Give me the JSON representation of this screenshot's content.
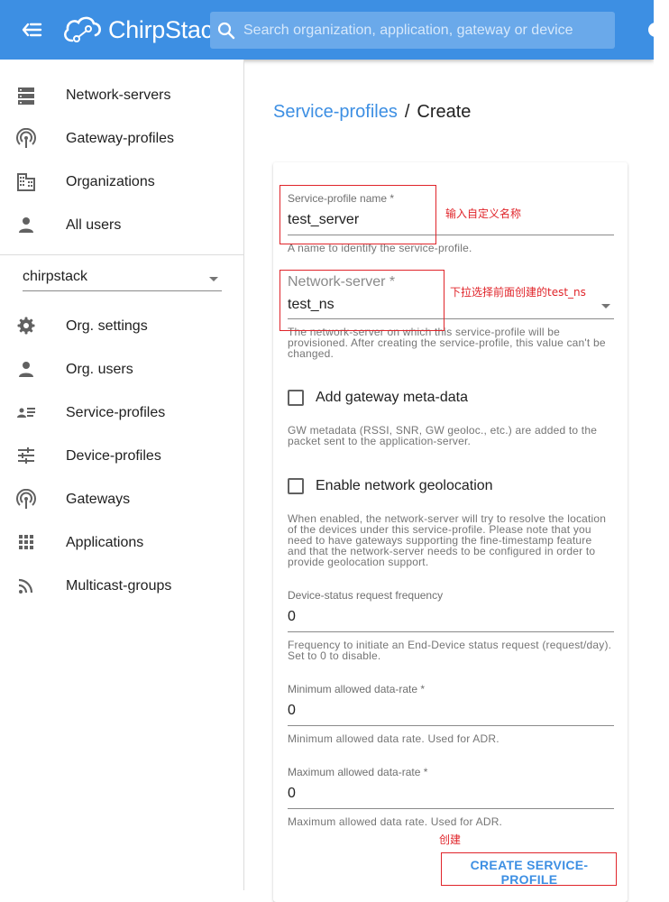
{
  "header": {
    "logo_text": "ChirpStack",
    "search_placeholder": "Search organization, application, gateway or device"
  },
  "sidebar": {
    "admin_items": [
      {
        "label": "Network-servers",
        "icon": "server-icon"
      },
      {
        "label": "Gateway-profiles",
        "icon": "radio-tower-icon"
      },
      {
        "label": "Organizations",
        "icon": "building-icon"
      },
      {
        "label": "All users",
        "icon": "person-icon"
      }
    ],
    "organization_select": "chirpstack",
    "org_items": [
      {
        "label": "Org. settings",
        "icon": "gear-icon"
      },
      {
        "label": "Org. users",
        "icon": "person-icon"
      },
      {
        "label": "Service-profiles",
        "icon": "account-list-icon"
      },
      {
        "label": "Device-profiles",
        "icon": "tune-icon"
      },
      {
        "label": "Gateways",
        "icon": "radio-tower-icon"
      },
      {
        "label": "Applications",
        "icon": "apps-grid-icon"
      },
      {
        "label": "Multicast-groups",
        "icon": "rss-feed-icon"
      }
    ]
  },
  "breadcrumb": {
    "parent": "Service-profiles",
    "separator": "/",
    "current": "Create"
  },
  "form": {
    "name": {
      "label": "Service-profile name *",
      "value": "test_server",
      "helper": "A name to identify the service-profile."
    },
    "network_server": {
      "label": "Network-server *",
      "value": "test_ns",
      "helper": "The network-server on which this service-profile will be provisioned. After creating the service-profile, this value can't be changed."
    },
    "add_gw_metadata": {
      "label": "Add gateway meta-data",
      "checked": false,
      "helper": "GW metadata (RSSI, SNR, GW geoloc., etc.) are added to the packet sent to the application-server."
    },
    "network_geolocation": {
      "label": "Enable network geolocation",
      "checked": false,
      "helper": "When enabled, the network-server will try to resolve the location of the devices under this service-profile. Please note that you need to have gateways supporting the fine-timestamp feature and that the network-server needs to be configured in order to provide geolocation support."
    },
    "dev_status_freq": {
      "label": "Device-status request frequency",
      "value": "0",
      "helper": "Frequency to initiate an End-Device status request (request/day). Set to 0 to disable."
    },
    "min_dr": {
      "label": "Minimum allowed data-rate *",
      "value": "0",
      "helper": "Minimum allowed data rate. Used for ADR."
    },
    "max_dr": {
      "label": "Maximum allowed data-rate *",
      "value": "0",
      "helper": "Maximum allowed data rate. Used for ADR."
    },
    "submit_label": "CREATE SERVICE-PROFILE"
  },
  "annotations": {
    "name_note": "输入自定义名称",
    "ns_note": "下拉选择前面创建的test_ns",
    "create_note": "创建"
  },
  "colors": {
    "appbar": "#3d8fe3",
    "accent": "#3d8fe3",
    "annotation_red": "#e0242a"
  }
}
